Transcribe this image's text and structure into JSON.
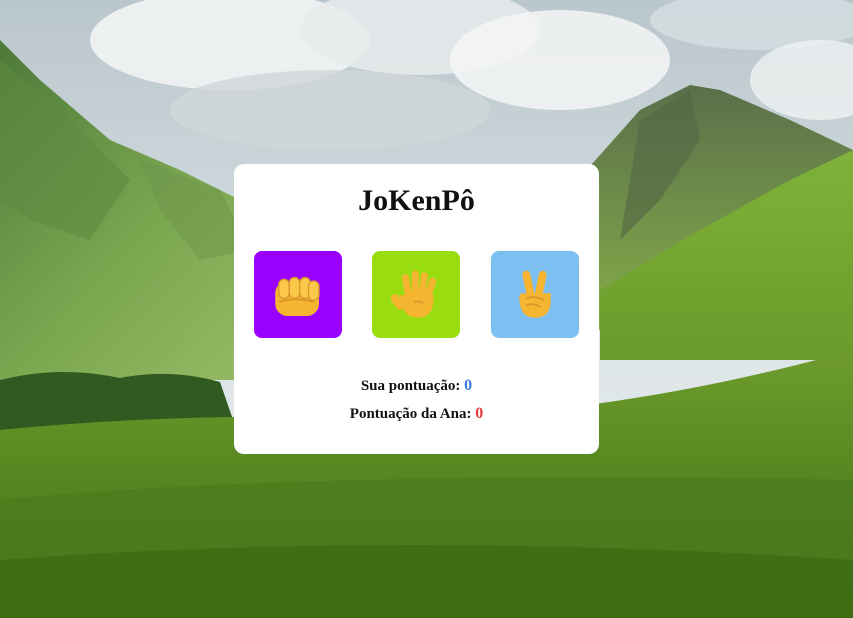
{
  "game": {
    "title": "JoKenPô",
    "choices": [
      {
        "id": "rock",
        "icon": "fist-icon",
        "color": "#9900ff"
      },
      {
        "id": "paper",
        "icon": "open-hand-icon",
        "color": "#99dd11"
      },
      {
        "id": "scissors",
        "icon": "victory-hand-icon",
        "color": "#7dbff0"
      }
    ]
  },
  "scores": {
    "player_label": "Sua pontuação:",
    "player_value": "0",
    "player_color": "#3a7bd5",
    "ana_label": "Pontuação da Ana:",
    "ana_value": "0",
    "ana_color": "#e53935"
  }
}
